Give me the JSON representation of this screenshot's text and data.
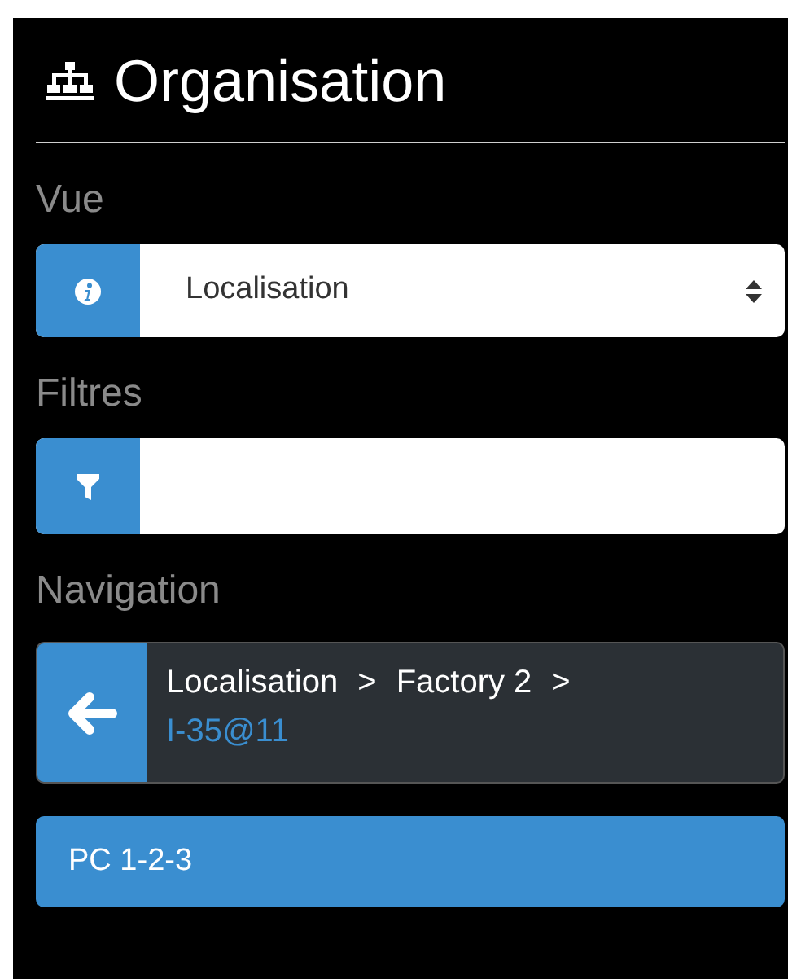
{
  "title": "Organisation",
  "view": {
    "label": "Vue",
    "value": "Localisation"
  },
  "filters": {
    "label": "Filtres"
  },
  "navigation": {
    "label": "Navigation",
    "path": [
      {
        "label": "Localisation",
        "current": false
      },
      {
        "separator": ">",
        "label": "Factory 2",
        "current": false
      },
      {
        "separator": ">",
        "label": "I-35@11",
        "current": true
      }
    ]
  },
  "items": [
    {
      "label": "PC 1-2-3",
      "selected": true
    }
  ]
}
